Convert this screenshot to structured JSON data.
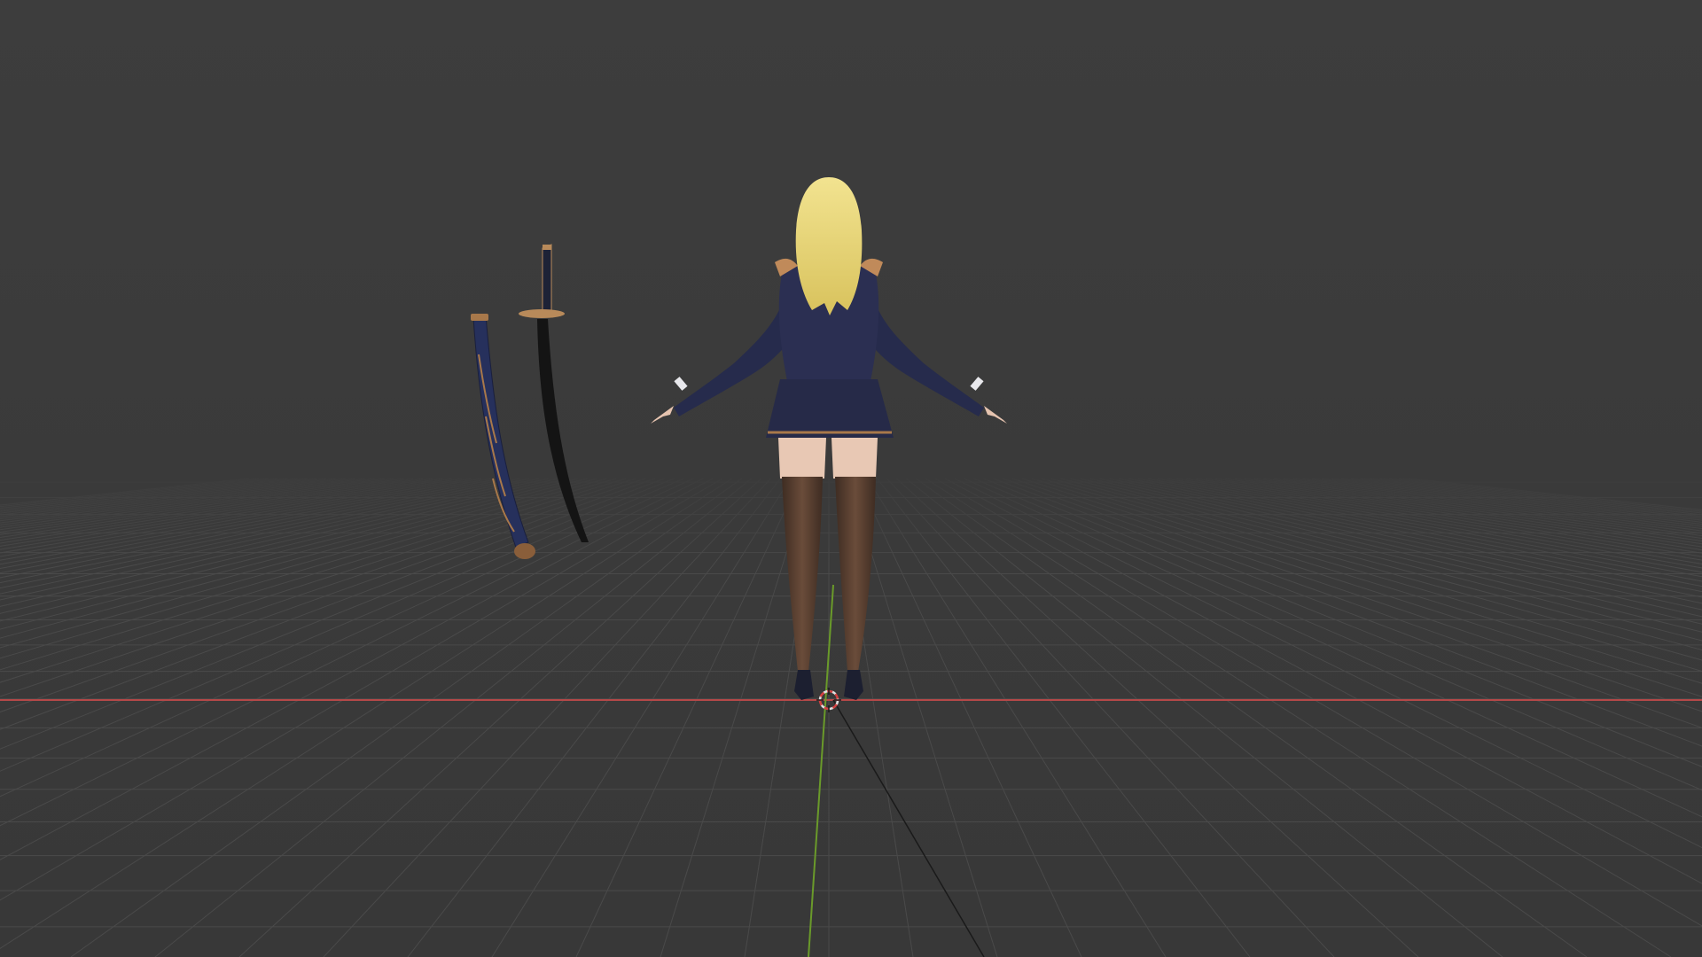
{
  "viewport": {
    "name": "3D Viewport",
    "background_color": "#3a3a3a",
    "grid_color": "#4a4a4a",
    "axis_x_color": "#b54848",
    "axis_y_color": "#6a9a2a",
    "cursor_icon": "3d-cursor-icon"
  },
  "scene": {
    "objects": [
      {
        "kind": "character",
        "description_icon": "character-model",
        "hair_color": "#e9d77a",
        "jacket_color": "#2b2f52",
        "stocking_color": "#5a4032"
      },
      {
        "kind": "katana",
        "description_icon": "sword-model",
        "blade_color": "#141414",
        "guard_color": "#b88a5a"
      },
      {
        "kind": "scabbard",
        "description_icon": "scabbard-model",
        "body_color": "#26305c",
        "trim_color": "#a8784a"
      }
    ]
  }
}
